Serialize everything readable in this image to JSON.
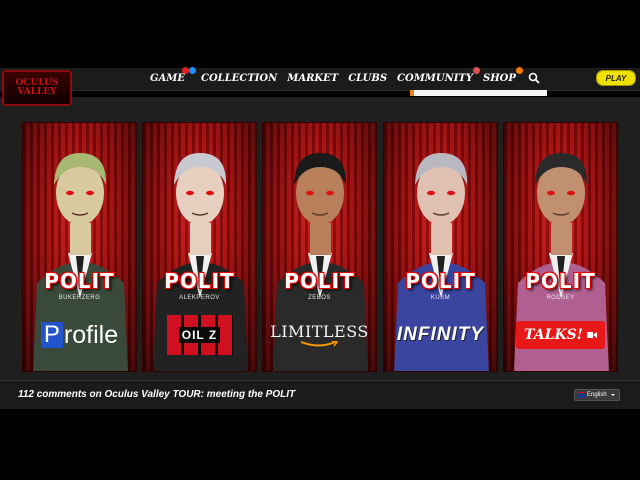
{
  "site": {
    "logo_text": "OCULUS VALLEY",
    "play_label": "PLAY"
  },
  "nav": {
    "items": [
      {
        "label": "GAME",
        "badges": [
          "#e02020",
          "#1e90ff"
        ]
      },
      {
        "label": "COLLECTION",
        "badges": []
      },
      {
        "label": "MARKET",
        "badges": []
      },
      {
        "label": "CLUBS",
        "badges": []
      },
      {
        "label": "COMMUNITY",
        "badges": [
          "#e05050"
        ]
      },
      {
        "label": "SHOP",
        "badges": [
          "#ff7a00"
        ]
      }
    ],
    "search_icon": "search-icon"
  },
  "cards": [
    {
      "title": "POLIT",
      "name": "BUKERZERG",
      "brand": "Profile",
      "brand_color": "#2255cc",
      "hair": "#a8b870",
      "suit": "#3a4a3a",
      "skin": "#d9c9a0"
    },
    {
      "title": "POLIT",
      "name": "ALEKPEROV",
      "brand": "OIL Z",
      "brand_color": "#d01020",
      "hair": "#c8c8d0",
      "suit": "#222222",
      "skin": "#e8d0c0"
    },
    {
      "title": "POLIT",
      "name": "ZEBOS",
      "brand": "LIMITLESS",
      "brand_color": "#ff9900",
      "hair": "#1a1a1a",
      "suit": "#2a2a2a",
      "skin": "#b8805a"
    },
    {
      "title": "POLIT",
      "name": "KUSM",
      "brand": "INFINITY",
      "brand_color": "#4050b0",
      "hair": "#b8b8c0",
      "suit": "#3a45a0",
      "skin": "#e0c0b0"
    },
    {
      "title": "POLIT",
      "name": "RODSEY",
      "brand": "TALKS!",
      "brand_color": "#e81818",
      "hair": "#2a2a2a",
      "suit": "#b06090",
      "skin": "#c09070"
    }
  ],
  "comments": {
    "text": "112 comments on Oculus Valley TOUR: meeting the POLIT"
  },
  "language": {
    "selected": "English",
    "flag_icon": "uk-flag-icon"
  }
}
